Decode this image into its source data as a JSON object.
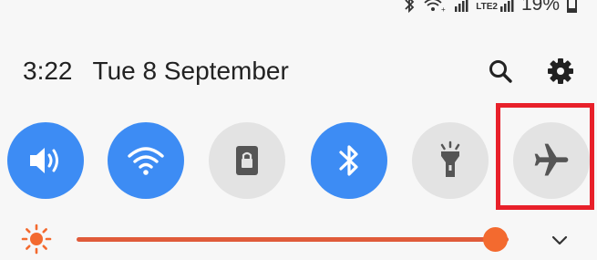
{
  "status_bar": {
    "network_label": "LTE2",
    "battery_text": "19%",
    "battery_level": 0.19,
    "icons": [
      "bluetooth-icon",
      "wifi-calling-icon",
      "signal-icon",
      "lte-signal-icon",
      "battery-icon"
    ]
  },
  "header": {
    "time": "3:22",
    "date": "Tue 8 September",
    "actions": [
      "search-icon",
      "settings-gear-icon"
    ]
  },
  "quick_tiles": [
    {
      "name": "sound",
      "icon": "volume-icon",
      "state": "on"
    },
    {
      "name": "wifi",
      "icon": "wifi-icon",
      "state": "on"
    },
    {
      "name": "lock",
      "icon": "screen-lock-icon",
      "state": "off"
    },
    {
      "name": "bluetooth",
      "icon": "bluetooth-icon",
      "state": "on"
    },
    {
      "name": "flashlight",
      "icon": "flashlight-icon",
      "state": "off"
    },
    {
      "name": "airplane",
      "icon": "airplane-icon",
      "state": "off",
      "highlighted": true
    }
  ],
  "brightness": {
    "level": 0.97,
    "icon": "sun-icon"
  },
  "colors": {
    "tile_on": "#3d8cf4",
    "tile_off": "#e3e3e3",
    "accent": "#f36a2f",
    "highlight": "#e8202a"
  }
}
